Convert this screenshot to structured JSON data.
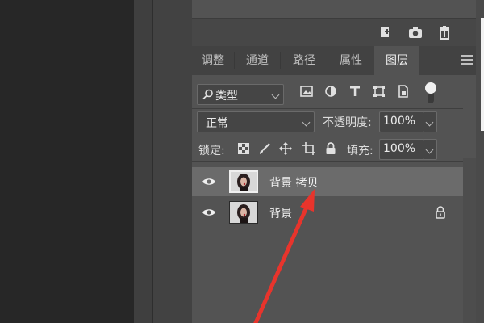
{
  "tabs": [
    "调整",
    "通道",
    "路径",
    "属性",
    "图层"
  ],
  "active_tab": "图层",
  "filter": {
    "icon": "search-icon",
    "label": "类型"
  },
  "filter_icons": [
    "image-filter-icon",
    "adjustment-filter-icon",
    "type-filter-icon",
    "shape-filter-icon",
    "smart-object-filter-icon"
  ],
  "blend_mode": "正常",
  "opacity": {
    "label": "不透明度:",
    "value": "100%"
  },
  "lock": {
    "label": "锁定:",
    "icons": [
      "lock-transparent-pixels-icon",
      "lock-image-pixels-icon",
      "lock-position-icon",
      "lock-artboard-icon",
      "lock-all-icon"
    ]
  },
  "fill": {
    "label": "填充:",
    "value": "100%"
  },
  "layers": [
    {
      "name": "背景 拷贝",
      "visible": true,
      "selected": true,
      "locked": false
    },
    {
      "name": "背景",
      "visible": true,
      "selected": false,
      "locked": true
    }
  ],
  "actions": [
    "new-layer-icon",
    "camera-icon",
    "trash-icon"
  ],
  "colors": {
    "panel": "#535353",
    "selected_row": "#6b6b6b",
    "arrow": "#e8342c"
  }
}
